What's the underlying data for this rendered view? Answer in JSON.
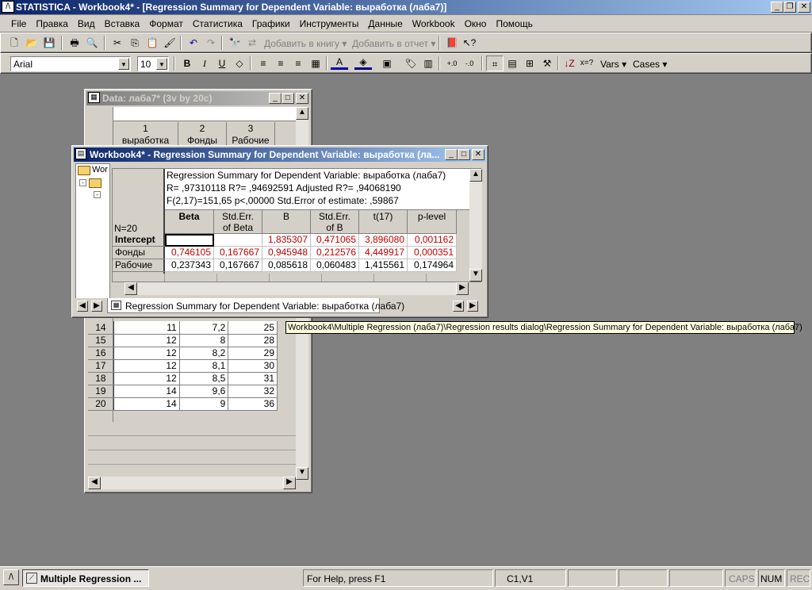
{
  "app": {
    "title": "STATISTICA - Workbook4* - [Regression Summary for Dependent Variable: выработка (лаба7)]"
  },
  "menu": [
    "File",
    "Правка",
    "Вид",
    "Вставка",
    "Формат",
    "Статистика",
    "Графики",
    "Инструменты",
    "Данные",
    "Workbook",
    "Окно",
    "Помощь"
  ],
  "toolbar": {
    "add_workbook": "Добавить в книгу",
    "add_report": "Добавить в отчет",
    "font_name": "Arial",
    "font_size": "10",
    "vars": "Vars",
    "cases": "Cases",
    "b": "B",
    "i": "I",
    "u": "U",
    "xq": "x=?"
  },
  "data_window": {
    "title": "Data: лаба7* (3v by 20c)",
    "col_headers": [
      [
        "1",
        "выработка"
      ],
      [
        "2",
        "Фонды"
      ],
      [
        "3",
        "Рабочие"
      ]
    ],
    "rows": [
      {
        "n": "14",
        "a": "11",
        "b": "7,2",
        "c": "25"
      },
      {
        "n": "15",
        "a": "12",
        "b": "8",
        "c": "28"
      },
      {
        "n": "16",
        "a": "12",
        "b": "8,2",
        "c": "29"
      },
      {
        "n": "17",
        "a": "12",
        "b": "8,1",
        "c": "30"
      },
      {
        "n": "18",
        "a": "12",
        "b": "8,5",
        "c": "31"
      },
      {
        "n": "19",
        "a": "14",
        "b": "9,6",
        "c": "32"
      },
      {
        "n": "20",
        "a": "14",
        "b": "9",
        "c": "36"
      }
    ]
  },
  "workbook": {
    "title": "Workbook4* - Regression Summary for Dependent Variable: выработка (ла...",
    "tree_label": "Wor",
    "header_lines": [
      "Regression Summary for Dependent Variable: выработка (лаба7)",
      "R= ,97310118 R?= ,94692591 Adjusted R?= ,94068190",
      "F(2,17)=151,65 p<,00000 Std.Error of estimate: ,59867"
    ],
    "n_label": "N=20",
    "columns": [
      [
        "Beta",
        ""
      ],
      [
        "Std.Err.",
        "of Beta"
      ],
      [
        "B",
        ""
      ],
      [
        "Std.Err.",
        "of B"
      ],
      [
        "t(17)",
        ""
      ],
      [
        "p-level",
        ""
      ]
    ],
    "rows": [
      {
        "label": "Intercept",
        "vals": [
          "",
          "",
          "1,835307",
          "0,471065",
          "3,896080",
          "0,001162"
        ],
        "red": true
      },
      {
        "label": "Фонды",
        "vals": [
          "0,746105",
          "0,167667",
          "0,945948",
          "0,212576",
          "4,449917",
          "0,000351"
        ],
        "red": true
      },
      {
        "label": "Рабочие",
        "vals": [
          "0,237343",
          "0,167667",
          "0,085618",
          "0,060483",
          "1,415561",
          "0,174964"
        ],
        "red": false
      }
    ],
    "tab_label": "Regression Summary for Dependent Variable: выработка (лаба7)"
  },
  "tooltip": "Workbook4\\Multiple Regression (лаба7)\\Regression results dialog\\Regression Summary for Dependent Variable: выработка (лаба7)",
  "taskbar": {
    "item": "Multiple Regression ..."
  },
  "status": {
    "help": "For Help, press F1",
    "cell": "C1,V1",
    "caps": "CAPS",
    "num": "NUM",
    "rec": "REC"
  }
}
